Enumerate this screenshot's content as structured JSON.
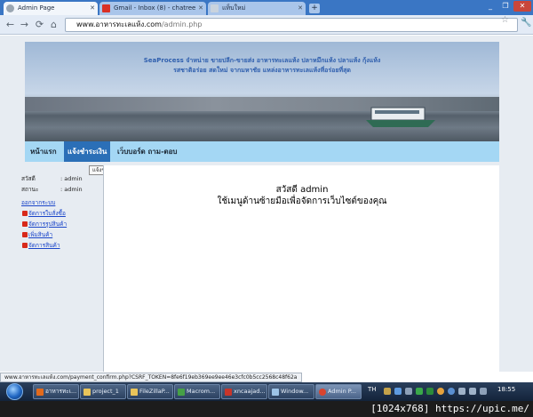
{
  "browser": {
    "tabs": [
      {
        "label": "Admin Page",
        "active": true
      },
      {
        "label": "Gmail - Inbox (8) - chatree",
        "active": false
      },
      {
        "label": "แท็บใหม่",
        "active": false
      }
    ],
    "new_tab_label": "+",
    "url_host": "www.อาหารทะเลแห้ง.com",
    "url_path": "/admin.php"
  },
  "site": {
    "tagline_line1": "SeaProcess จำหน่าย ขายปลีก-ขายส่ง อาหารทะเลแห้ง ปลาหมึกแห้ง ปลาแห้ง กุ้งแห้ง",
    "tagline_line2": "รสชาติอร่อย สดใหม่ จากมหาชัย แหล่งอาหารทะเลแห้งที่อร่อยที่สุด",
    "menu": [
      {
        "label": "หน้าแรก"
      },
      {
        "label": "แจ้งชำระเงิน",
        "current": true
      },
      {
        "label": "เว็บบอร์ด ถาม-ตอบ"
      }
    ],
    "tooltip": "แจ้งชำระเงิน"
  },
  "sidebar": {
    "greeting_label": "สวัสดี",
    "greeting_value": ": admin",
    "status_label": "สถานะ",
    "status_value": ": admin",
    "logout": "ออกจากระบบ",
    "actions": [
      {
        "label": "จัดการใบสั่งซื้อ"
      },
      {
        "label": "จัดการรูปสินค้า"
      },
      {
        "label": "เพิ่มสินค้า"
      },
      {
        "label": "จัดการสินค้า"
      }
    ]
  },
  "content": {
    "greeting": "สวัสดี admin",
    "instruction": "ใช้เมนูด้านซ้ายมือเพื่อจัดการเว็บไซต์ของคุณ"
  },
  "status_url": "www.อาหารทะเลแห้ง.com/payment_confirm.php?CSRF_TOKEN=8fe6f19eb369ee9ee46e3cfc0b5cc2568c48f62a",
  "taskbar": {
    "buttons": [
      {
        "label": "อาหารทะเ...",
        "icon_color": "#e36a1b",
        "active": false
      },
      {
        "label": "project_1",
        "icon_color": "#e9c45a",
        "active": false
      },
      {
        "label": "FileZillaP...",
        "icon_color": "#e9c45a",
        "active": false
      },
      {
        "label": "Macrom...",
        "icon_color": "#46a046",
        "active": false
      },
      {
        "label": "xncaajad...",
        "icon_color": "#c8352a",
        "active": false
      },
      {
        "label": "Window...",
        "icon_color": "#9dc3e6",
        "active": false
      },
      {
        "label": "Admin P...",
        "icon_color": "#d9442f",
        "active": true
      }
    ],
    "lang": "TH",
    "clock": "18:55"
  },
  "watermark": "[1024x768] https://upic.me/"
}
